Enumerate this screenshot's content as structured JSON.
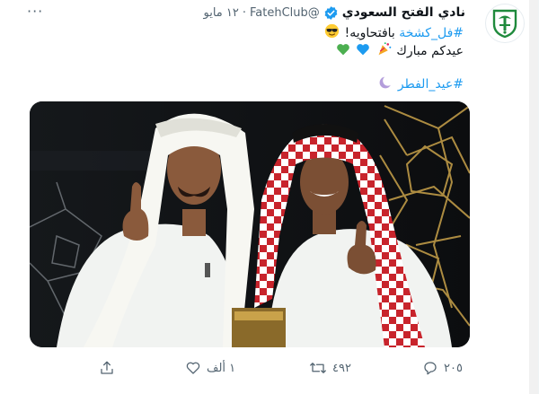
{
  "tweet": {
    "account_name": "نادي الفتح السعودي",
    "handle": "@FatehClub",
    "separator": "·",
    "date": "١٢ مايو",
    "more_label": "···",
    "line1_hashtag": "#فل_كشخة",
    "line1_text": "بافتحاويه!",
    "line2_text": "عيدكم مبارك",
    "line3_hashtag": "#عيد_الفطر"
  },
  "actions": {
    "reply_count": "٢٠٥",
    "retweet_count": "٤٩٢",
    "like_count": "١ ألف"
  },
  "colors": {
    "accent": "#1d9bf0",
    "club_green": "#1f8a3c",
    "secondary_text": "#536471"
  }
}
